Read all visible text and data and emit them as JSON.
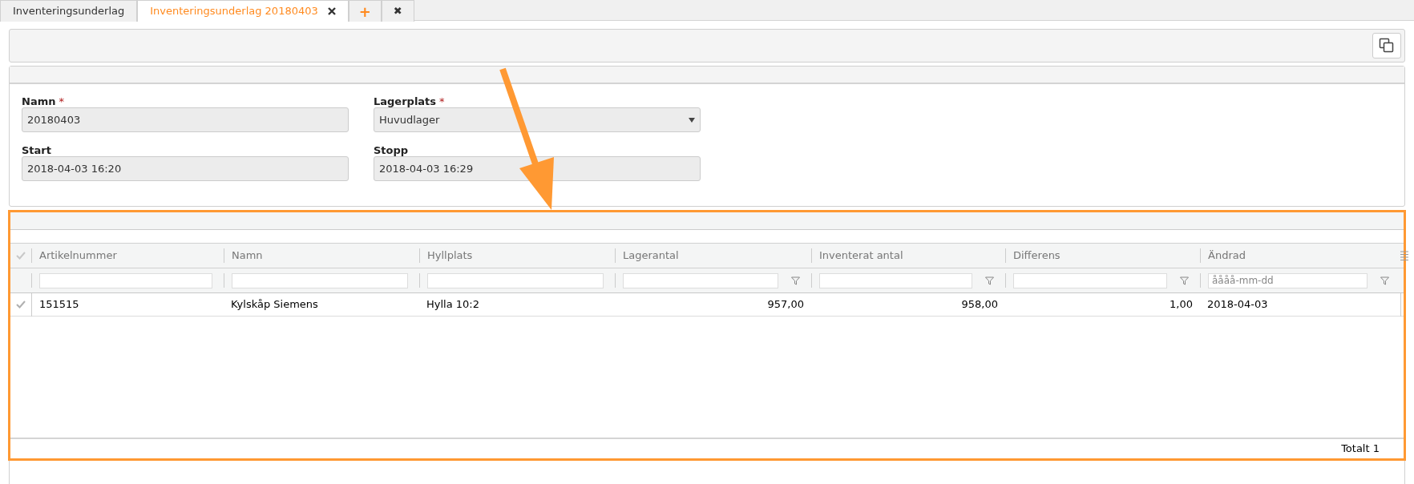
{
  "tabs": [
    {
      "label": "Inventeringsunderlag",
      "selected": false,
      "closable": false
    },
    {
      "label": "Inventeringsunderlag 20180403",
      "selected": true,
      "closable": true
    },
    {
      "label": "+",
      "selected": false,
      "closable": false,
      "kind": "add"
    },
    {
      "label": "✖",
      "selected": false,
      "closable": false,
      "kind": "close-all"
    }
  ],
  "form": {
    "fields": [
      {
        "label": "Namn",
        "required_mark": "*",
        "value": "20180403",
        "kind": "text"
      },
      {
        "label": "Lagerplats",
        "required_mark": "*",
        "value": "Huvudlager",
        "kind": "select"
      },
      {
        "label": "Start",
        "value": "2018-04-03 16:20",
        "kind": "text"
      },
      {
        "label": "Stopp",
        "value": "2018-04-03 16:29",
        "kind": "text"
      }
    ]
  },
  "grid": {
    "columns": [
      {
        "label": "Artikelnummer",
        "right_aligned": false,
        "filter_button": false
      },
      {
        "label": "Namn",
        "right_aligned": false,
        "filter_button": false
      },
      {
        "label": "Hyllplats",
        "right_aligned": false,
        "filter_button": false
      },
      {
        "label": "Lagerantal",
        "right_aligned": true,
        "filter_button": true
      },
      {
        "label": "Inventerat antal",
        "right_aligned": true,
        "filter_button": true
      },
      {
        "label": "Differens",
        "right_aligned": true,
        "filter_button": true
      },
      {
        "label": "Ändrad",
        "right_aligned": false,
        "filter_button": true,
        "placeholder": "åååå-mm-dd"
      }
    ],
    "rows": [
      {
        "cells": [
          "151515",
          "Kylskåp Siemens",
          "Hylla 10:2",
          "957,00",
          "958,00",
          "1,00",
          "2018-04-03"
        ]
      }
    ],
    "total": "Totalt 1"
  }
}
